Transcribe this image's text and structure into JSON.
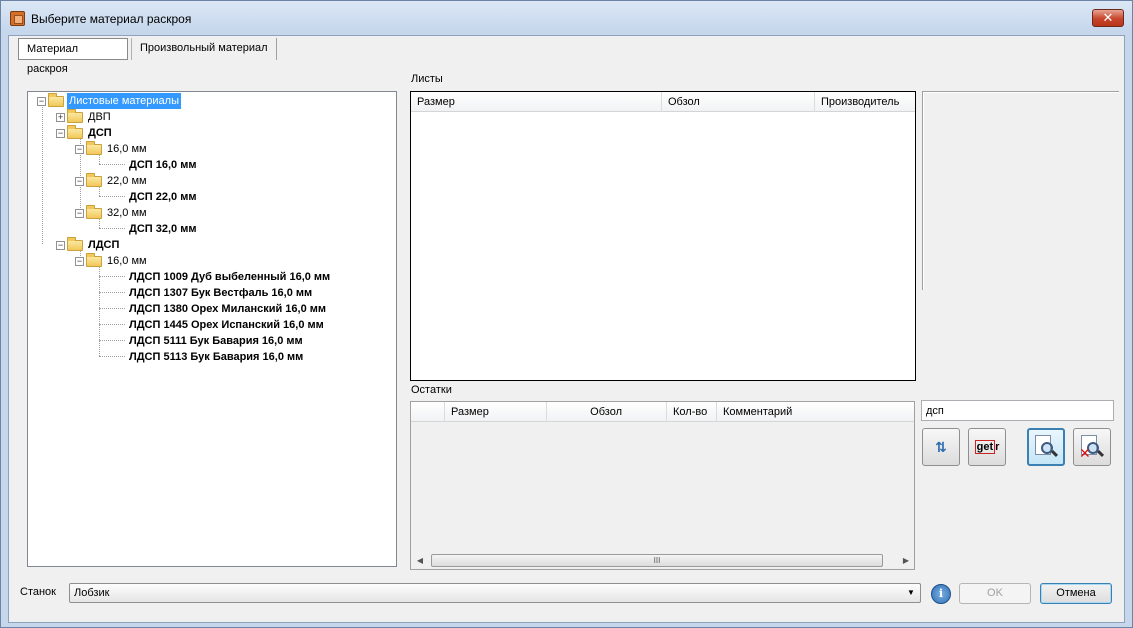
{
  "window": {
    "title": "Выберите материал раскроя",
    "close_glyph": "✕"
  },
  "tabs": [
    {
      "label": "Материал раскроя",
      "active": true
    },
    {
      "label": "Произвольный материал",
      "active": false
    }
  ],
  "tree": {
    "root": "Листовые материалы",
    "nodes": {
      "dvp": "ДВП",
      "dsp": "ДСП",
      "dsp_16": "16,0 мм",
      "dsp_16_item": "ДСП 16,0 мм",
      "dsp_22": "22,0 мм",
      "dsp_22_item": "ДСП 22,0 мм",
      "dsp_32": "32,0 мм",
      "dsp_32_item": "ДСП 32,0 мм",
      "ldsp": "ЛДСП",
      "ldsp_16": "16,0 мм",
      "ldsp_items": [
        "ЛДСП 1009 Дуб выбеленный 16,0 мм",
        "ЛДСП 1307 Бук Вестфаль 16,0 мм",
        "ЛДСП 1380 Орех Миланский 16,0 мм",
        "ЛДСП 1445 Орех Испанский 16,0 мм",
        "ЛДСП 5111 Бук Бавария 16,0 мм",
        "ЛДСП 5113 Бук Бавария 16,0 мм"
      ]
    }
  },
  "sheets": {
    "label": "Листы",
    "columns": [
      "Размер",
      "Обзол",
      "Производитель"
    ]
  },
  "remnants": {
    "label": "Остатки",
    "columns": [
      "",
      "Размер",
      "Обзол",
      "Кол-во",
      "Комментарий"
    ],
    "scroll_thumb": "III"
  },
  "filter": {
    "value": "дсп"
  },
  "toolbar": {
    "getr_label_a": "get",
    "getr_label_b": "r"
  },
  "bottom": {
    "machine_label": "Станок",
    "machine_value": "Лобзик",
    "ok_label": "OK",
    "cancel_label": "Отмена",
    "info_glyph": "i"
  },
  "colors": {
    "selection": "#3399ff",
    "folder": "#f1c859",
    "close_red": "#c7452c"
  }
}
